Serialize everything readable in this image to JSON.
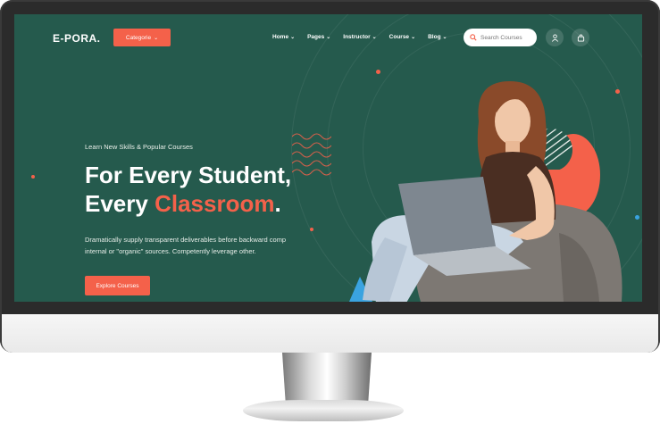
{
  "brand": {
    "logo": "E-PORA."
  },
  "header": {
    "category_label": "Categorie",
    "nav": [
      {
        "label": "Home"
      },
      {
        "label": "Pages"
      },
      {
        "label": "Instructor"
      },
      {
        "label": "Course"
      },
      {
        "label": "Blog"
      }
    ],
    "search_placeholder": "Search Courses"
  },
  "hero": {
    "eyebrow": "Learn New Skills & Popular Courses",
    "headline_line1": "For Every Student,",
    "headline_line2_prefix": "Every ",
    "headline_line2_accent": "Classroom",
    "headline_line2_suffix": ".",
    "description": "Dramatically supply transparent deliverables before backward comp internal or \"organic\" sources. Competently leverage other.",
    "cta": "Explore Courses"
  },
  "colors": {
    "background": "#255a4d",
    "accent": "#f4614a",
    "text": "#ffffff"
  },
  "icons": [
    "chevron-down-icon",
    "search-icon",
    "user-icon",
    "cart-icon"
  ]
}
